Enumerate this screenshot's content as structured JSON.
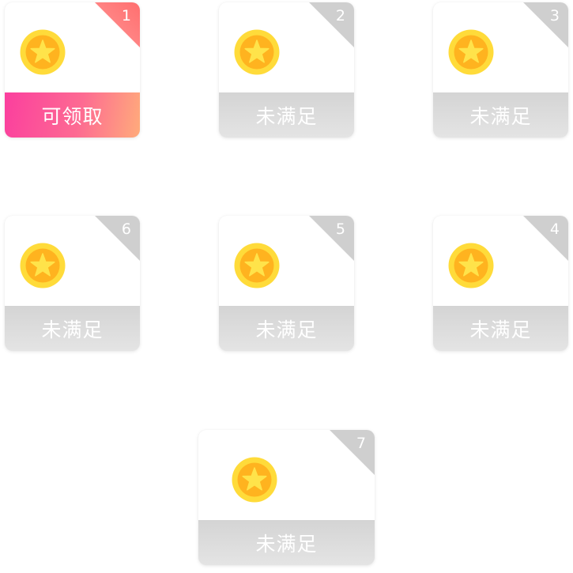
{
  "colors": {
    "claimable_gradient_start": "#fb3f9e",
    "claimable_gradient_end": "#ffab7b",
    "corner_active": "#ff7e7e",
    "inactive_gray": "#d6d6d6",
    "coin_outer": "#ffdb3a",
    "coin_inner": "#ffb31f",
    "star": "#ffe34a"
  },
  "cards": [
    {
      "number": "1",
      "status": "可领取",
      "state": "claimable",
      "icon": "gold-star-coin-icon"
    },
    {
      "number": "2",
      "status": "未满足",
      "state": "unmet",
      "icon": "gold-star-coin-icon"
    },
    {
      "number": "3",
      "status": "未满足",
      "state": "unmet",
      "icon": "gold-star-coin-icon"
    },
    {
      "number": "6",
      "status": "未满足",
      "state": "unmet",
      "icon": "gold-star-coin-icon"
    },
    {
      "number": "5",
      "status": "未满足",
      "state": "unmet",
      "icon": "gold-star-coin-icon"
    },
    {
      "number": "4",
      "status": "未满足",
      "state": "unmet",
      "icon": "gold-star-coin-icon"
    },
    {
      "number": "7",
      "status": "未满足",
      "state": "unmet",
      "icon": "gold-star-coin-icon"
    }
  ]
}
